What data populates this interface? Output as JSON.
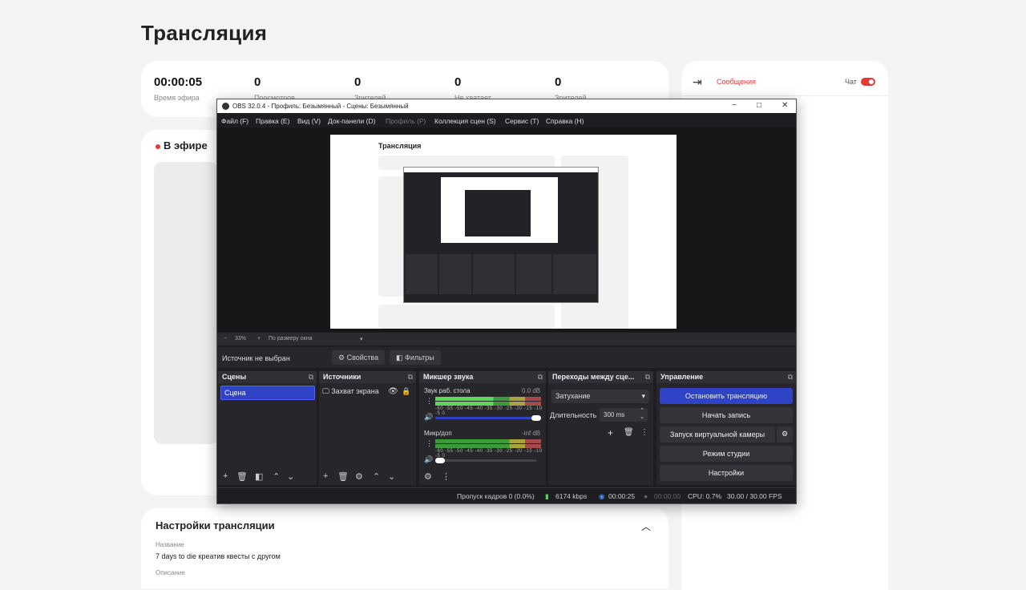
{
  "page": {
    "title": "Трансляция"
  },
  "stats": [
    {
      "value": "00:00:05",
      "label": "Время эфира"
    },
    {
      "value": "0",
      "label": "Просмотров"
    },
    {
      "value": "0",
      "label": "Зрителей"
    },
    {
      "value": "0",
      "label": "Не хватает"
    },
    {
      "value": "0",
      "label": "Зрителей"
    }
  ],
  "live": {
    "label": "В эфире"
  },
  "chat": {
    "tab_messages": "Сообщения",
    "chat_label": "Чат",
    "chat_enabled": true
  },
  "settings": {
    "title": "Настройки трансляции",
    "name_label": "Название",
    "name_value": "7 days to die креатив квесты с другом",
    "description_label": "Описание"
  },
  "obs": {
    "title": "OBS 32.0.4 - Профиль: Безымянный - Сцены: Безымянный",
    "menu": [
      "Файл (F)",
      "Правка (E)",
      "Вид (V)",
      "Док-панели (D)",
      "Профиль (P)",
      "Коллекция сцен (S)",
      "Сервис (T)",
      "Справка (H)"
    ],
    "preview_title": "Трансляция",
    "zoom": {
      "minus": "−",
      "percent": "33%",
      "plus": "+",
      "mode": "По размеру окна"
    },
    "source_bar": {
      "none_selected": "Источник не выбран",
      "properties": "Свойства",
      "filters": "Фильтры"
    },
    "docks": {
      "scenes": {
        "title": "Сцены",
        "items": [
          "Сцена"
        ]
      },
      "sources": {
        "title": "Источники",
        "items": [
          "Захват экрана"
        ]
      },
      "mixer": {
        "title": "Микшер звука",
        "channels": [
          {
            "name": "Звук раб. стола",
            "db": "0.0 dB",
            "level": 0.55
          },
          {
            "name": "Микр/доп",
            "db": "-inf dB",
            "level": 0
          }
        ],
        "scale": "-60 -55 -50 -45 -40 -35 -30 -25 -20 -15 -10 -5 0"
      },
      "transitions": {
        "title": "Переходы между сце...",
        "selected": "Затухание",
        "duration_label": "Длительность",
        "duration_value": "300 ms"
      },
      "controls": {
        "title": "Управление",
        "stop_stream": "Остановить трансляцию",
        "start_record": "Начать запись",
        "virtual_camera": "Запуск виртуальной камеры",
        "studio_mode": "Режим студии",
        "settings": "Настройки"
      }
    },
    "status": {
      "dropped_frames": "Пропуск кадров 0 (0.0%)",
      "bitrate": "6174 kbps",
      "stream_time": "00:00:25",
      "record_time": "00:00:00",
      "cpu": "CPU: 0.7%",
      "fps": "30.00 / 30.00 FPS"
    }
  }
}
